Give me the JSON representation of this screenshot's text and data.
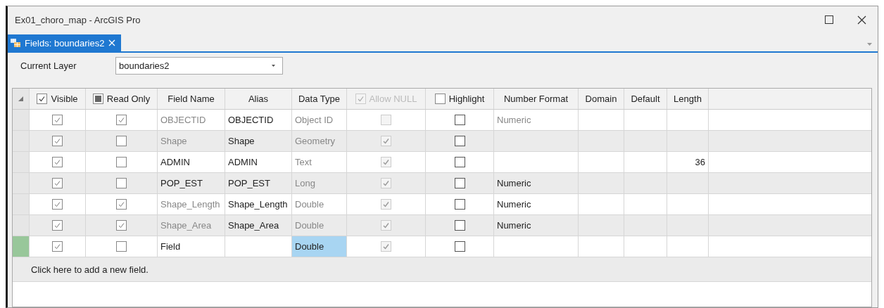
{
  "window": {
    "title": "Ex01_choro_map - ArcGIS Pro"
  },
  "tabs": [
    {
      "label": "Fields:  boundaries2",
      "selected": true
    }
  ],
  "current_layer": {
    "label": "Current Layer",
    "value": "boundaries2"
  },
  "table": {
    "columns": [
      {
        "label": "Visible",
        "kind": "checkbox",
        "checked": true,
        "disabled": false
      },
      {
        "label": "Read Only",
        "kind": "checkbox",
        "checked": false,
        "mixed": true,
        "disabled": false
      },
      {
        "label": "Field Name"
      },
      {
        "label": "Alias"
      },
      {
        "label": "Data Type"
      },
      {
        "label": "Allow NULL",
        "kind": "checkbox",
        "checked": true,
        "disabled": true
      },
      {
        "label": "Highlight",
        "kind": "checkbox",
        "checked": false,
        "disabled": false
      },
      {
        "label": "Number Format"
      },
      {
        "label": "Domain"
      },
      {
        "label": "Default"
      },
      {
        "label": "Length"
      }
    ],
    "rows": [
      {
        "visible": true,
        "read_only": true,
        "field_name": "OBJECTID",
        "field_name_greyed": true,
        "alias": "OBJECTID",
        "data_type": "Object ID",
        "data_type_greyed": true,
        "data_type_selected": false,
        "allow_null": false,
        "highlight": false,
        "number_format": "Numeric",
        "number_format_greyed": true,
        "editing": false
      },
      {
        "visible": true,
        "read_only": false,
        "field_name": "Shape",
        "field_name_greyed": true,
        "alias": "Shape",
        "data_type": "Geometry",
        "data_type_greyed": true,
        "data_type_selected": false,
        "allow_null": true,
        "highlight": false,
        "editing": false
      },
      {
        "visible": true,
        "read_only": false,
        "field_name": "ADMIN",
        "field_name_greyed": false,
        "alias": "ADMIN",
        "data_type": "Text",
        "data_type_greyed": true,
        "data_type_selected": false,
        "allow_null": true,
        "highlight": false,
        "length": "36",
        "editing": false
      },
      {
        "visible": true,
        "read_only": false,
        "field_name": "POP_EST",
        "field_name_greyed": false,
        "alias": "POP_EST",
        "data_type": "Long",
        "data_type_greyed": true,
        "data_type_selected": false,
        "allow_null": true,
        "highlight": false,
        "number_format": "Numeric",
        "number_format_greyed": false,
        "editing": false
      },
      {
        "visible": true,
        "read_only": true,
        "field_name": "Shape_Length",
        "field_name_greyed": true,
        "alias": "Shape_Length",
        "data_type": "Double",
        "data_type_greyed": true,
        "data_type_selected": false,
        "allow_null": true,
        "highlight": false,
        "number_format": "Numeric",
        "number_format_greyed": false,
        "editing": false
      },
      {
        "visible": true,
        "read_only": true,
        "field_name": "Shape_Area",
        "field_name_greyed": true,
        "alias": "Shape_Area",
        "data_type": "Double",
        "data_type_greyed": true,
        "data_type_selected": false,
        "allow_null": true,
        "highlight": false,
        "number_format": "Numeric",
        "number_format_greyed": false,
        "editing": false
      },
      {
        "visible": true,
        "read_only": false,
        "field_name": "Field",
        "field_name_greyed": false,
        "data_type": "Double",
        "data_type_greyed": false,
        "data_type_selected": true,
        "allow_null": true,
        "highlight": false,
        "editing": true
      }
    ],
    "add_row": "Click here to add a new field."
  }
}
